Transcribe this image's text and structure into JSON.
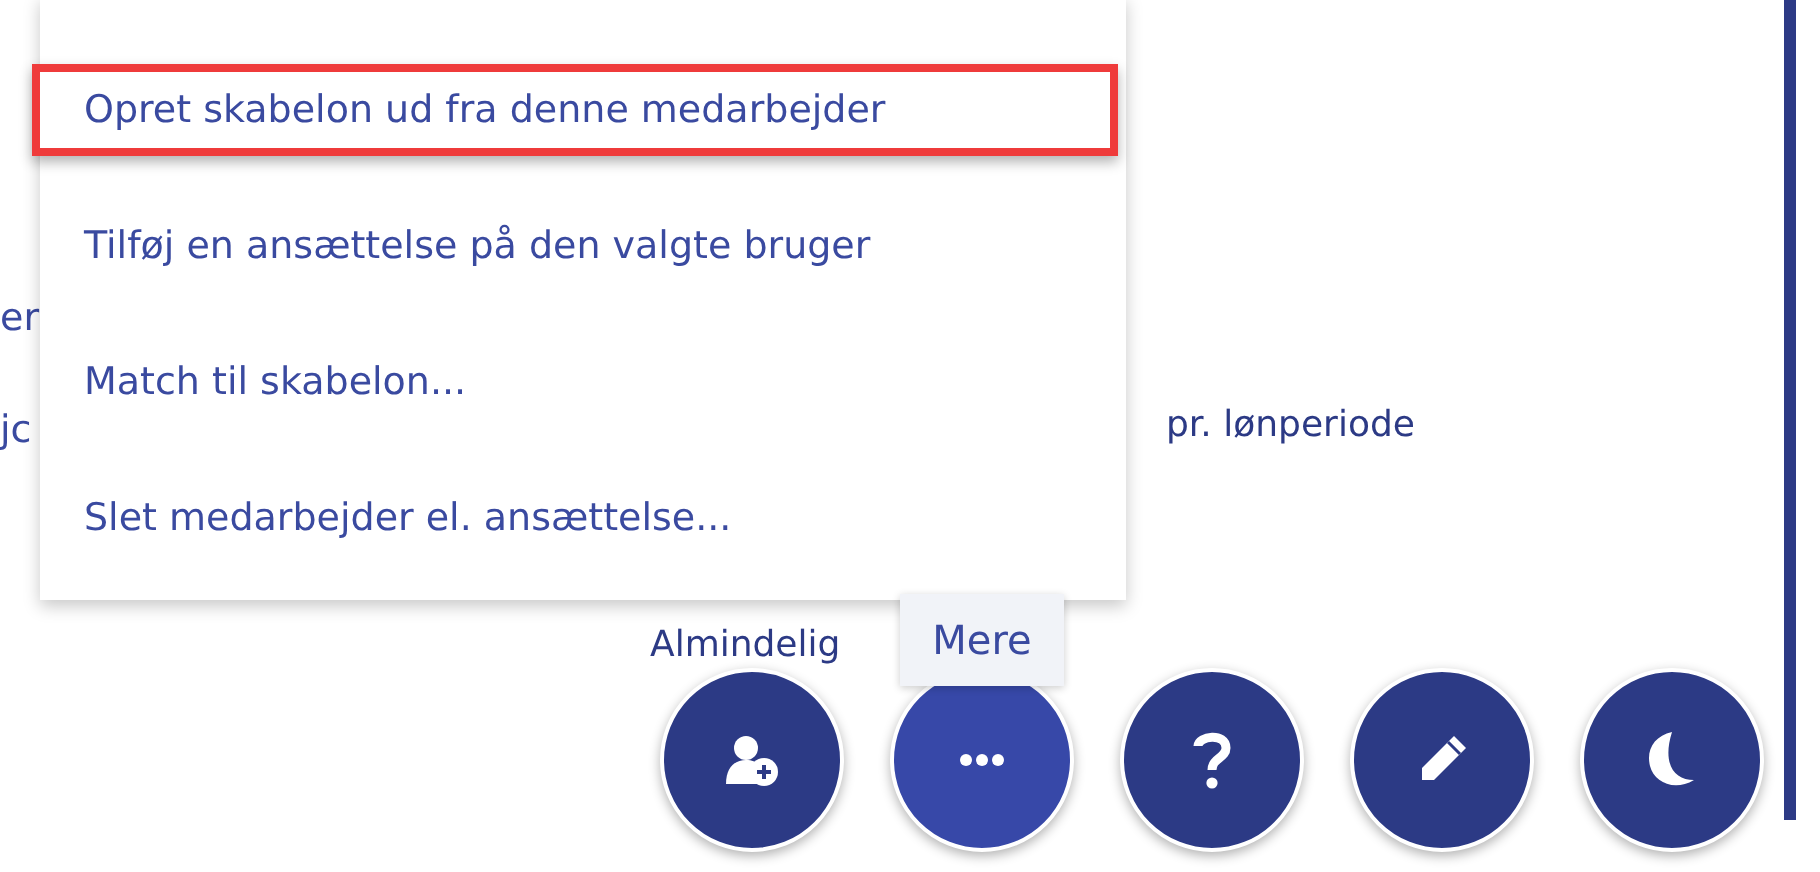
{
  "background": {
    "left_texts": [
      "er",
      "jc"
    ],
    "period_label": "pr. lønperiode",
    "field_label": "Almindelig"
  },
  "menu": {
    "items": [
      {
        "label": "Opret skabelon ud fra denne medarbejder",
        "highlighted": true
      },
      {
        "label": "Tilføj en ansættelse på den valgte bruger",
        "highlighted": false
      },
      {
        "label": "Match til skabelon...",
        "highlighted": false
      },
      {
        "label": "Slet medarbejder el. ansættelse...",
        "highlighted": false
      }
    ]
  },
  "tooltip": "Mere",
  "fab_buttons": [
    {
      "kind": "add-user",
      "selected": false
    },
    {
      "kind": "more",
      "selected": true
    },
    {
      "kind": "help",
      "selected": false
    },
    {
      "kind": "edit",
      "selected": false
    },
    {
      "kind": "dark-mode",
      "selected": false
    }
  ]
}
